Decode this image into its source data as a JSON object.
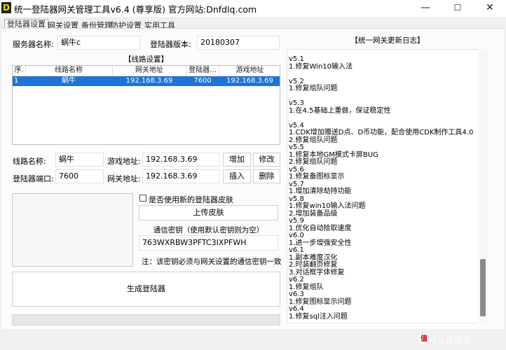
{
  "window": {
    "title": "统一登陆器网关管理工具v6.4 (尊享版)  官方网站:Dnfdlq.com",
    "icon_letter": "D",
    "controls": {
      "minimize": "—",
      "maximize": "☐",
      "close": "✕"
    }
  },
  "tabs": [
    "登陆器设置",
    "网关设置",
    "备份管理",
    "防护设置",
    "实用工具"
  ],
  "server": {
    "name_label": "服务器名称:",
    "name_value": "蜗牛c",
    "version_label": "登陆器版本:",
    "version_value": "20180307"
  },
  "lines": {
    "group_title": "【线路设置】",
    "columns": [
      "序.",
      "线路名称",
      "网关地址",
      "登陆器...",
      "游戏地址"
    ],
    "rows": [
      {
        "idx": "1",
        "name": "蜗牛",
        "gateway": "192.168.3.69",
        "port": "7600",
        "game": "192.168.3.69"
      }
    ],
    "line_name_label": "线路名称:",
    "line_name_value": "蜗牛",
    "game_addr_label": "游戏地址:",
    "game_addr_value": "192.168.3.69",
    "port_label": "登陆器端口:",
    "port_value": "7600",
    "gateway_label": "网关地址:",
    "gateway_value": "192.168.3.69",
    "add_button": "增加",
    "edit_button": "修改",
    "insert_button": "插入",
    "delete_button": "删除"
  },
  "skin": {
    "checkbox_label": "是否使用新的登陆器皮肤",
    "upload_button": "上传皮肤"
  },
  "key": {
    "title": "通信密钥（使用默认密钥则为空）",
    "value": "763WXRBW3PFTC3IXPFWH",
    "note": "注：该密钥必须与网关设置的通信密钥一致"
  },
  "generate_button": "生成登陆器",
  "changelog": {
    "title": "【统一网关更新日志】",
    "lines": [
      "v5.1",
      "1.修复Win10输入法",
      "",
      "v5.2",
      "1.修复组队问题",
      "",
      "v5.3",
      "1.在4.5基础上重做，保证稳定性",
      "",
      "v5.4",
      "1.CDK增加赠送D点、D币功能，配合使用CDK制作工具4.0",
      "2.修复组队问题",
      "v5.5",
      "1.修复本地GM模式卡屏BUG",
      "2.修复组队问题",
      "v5.6",
      "1.修复备图标显示",
      "v5.7",
      "1.增加清除劫持功能",
      "v5.8",
      "1.修复win10输入法问题",
      "2.增加装备品级",
      "v5.9",
      "1.优化自动拾取速度",
      "v6.0",
      "1.进一步增强安全性",
      "v6.1",
      "1.副本难度汉化",
      "2.时装翻页修复",
      "3.对话框字体修复",
      "v6.2",
      "1.修复组队",
      "v6.3",
      "1.修复图标显示问题",
      "v6.4",
      "1.修复sql注入问题"
    ]
  },
  "watermark": {
    "logo": "值",
    "text": "什么值得买"
  }
}
